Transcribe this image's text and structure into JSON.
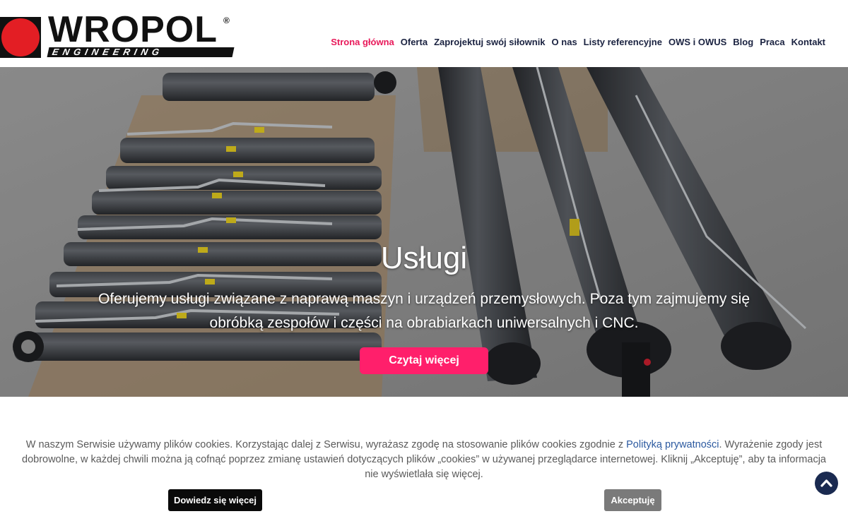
{
  "logo": {
    "name": "WROPOL",
    "registered": "®",
    "subtitle": "ENGINEERING"
  },
  "nav": {
    "items": [
      {
        "label": "Strona główna",
        "active": true
      },
      {
        "label": "Oferta"
      },
      {
        "label": "Zaprojektuj swój siłownik"
      },
      {
        "label": "O nas"
      },
      {
        "label": "Listy referencyjne"
      },
      {
        "label": "OWS i OWUS"
      },
      {
        "label": "Blog"
      },
      {
        "label": "Praca"
      },
      {
        "label": "Kontakt"
      }
    ]
  },
  "hero": {
    "title": "Usługi",
    "text": "Oferujemy usługi związane z naprawą maszyn i urządzeń przemysłowych. Poza tym zajmujemy się obróbką zespołów i części na obrabiarkach uniwersalnych i CNC.",
    "button": "Czytaj więcej"
  },
  "cookie": {
    "text_before": "W naszym Serwisie używamy plików cookies. Korzystając dalej z Serwisu, wyrażasz zgodę na stosowanie plików cookies zgodnie z ",
    "link": "Polityką prywatności",
    "text_after": ". Wyrażenie zgody jest dobrowolne, w każdej chwili można ją cofnąć poprzez zmianę ustawień dotyczących plików „cookies” w używanej przeglądarce internetowej. Kliknij „Akceptuję”, aby ta informacja nie wyświetlała się więcej.",
    "more_button": "Dowiedz się więcej",
    "accept_button": "Akceptuję"
  },
  "colors": {
    "accent": "#e8195a",
    "hero_button": "#ff1f6b",
    "nav_text": "#1a2240",
    "link": "#2c5aa0",
    "scroll_top": "#1a2a50"
  },
  "icons": {
    "scroll_top": "chevron-up-icon"
  }
}
